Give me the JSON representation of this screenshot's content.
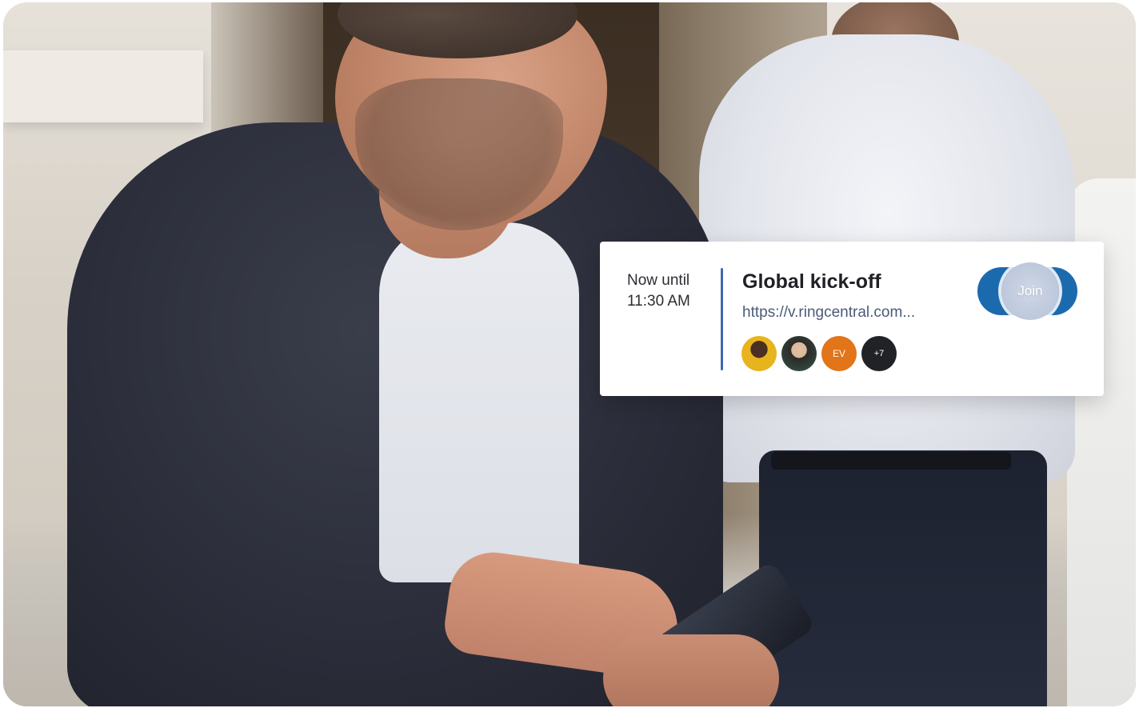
{
  "meeting_card": {
    "time_line1": "Now until",
    "time_line2": "11:30 AM",
    "title": "Global kick-off",
    "link": "https://v.ringcentral.com...",
    "attendees": [
      {
        "type": "photo",
        "name": "avatar-1"
      },
      {
        "type": "photo",
        "name": "avatar-2"
      },
      {
        "type": "initials",
        "label": "EV",
        "color": "#e2741a"
      },
      {
        "type": "count",
        "label": "+7",
        "color": "#212226"
      }
    ],
    "join_label": "Join",
    "accent_color": "#1c6aae",
    "divider_color": "#3f69ad"
  }
}
